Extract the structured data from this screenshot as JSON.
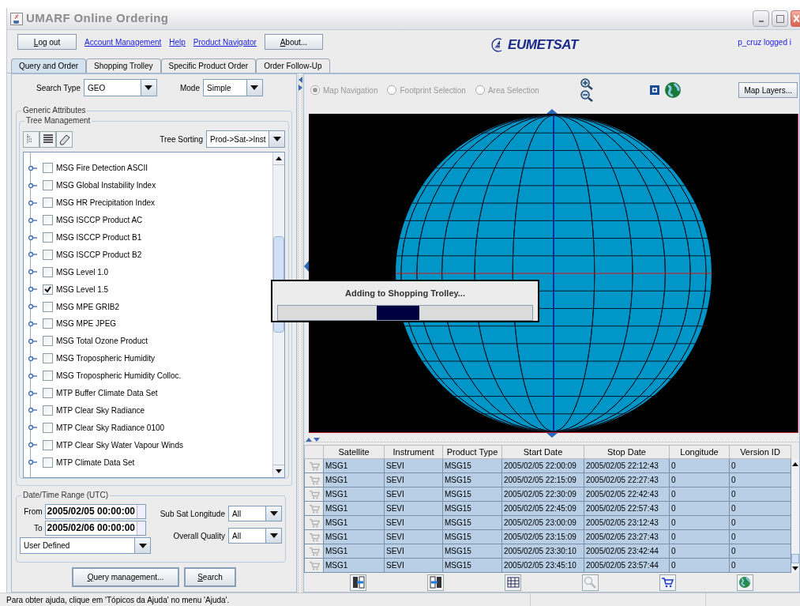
{
  "window": {
    "title": "UMARF Online Ordering"
  },
  "toolbar": {
    "logout_button": "Log out",
    "links": [
      "Account Management",
      "Help",
      "Product Navigator"
    ],
    "about_button": "About...",
    "logo": "EUMETSAT",
    "user": "p_cruz logged i"
  },
  "tabs": [
    {
      "label": "Query and Order",
      "selected": true
    },
    {
      "label": "Shopping Trolley",
      "selected": false
    },
    {
      "label": "Specific Product Order",
      "selected": false
    },
    {
      "label": "Order Follow-Up",
      "selected": false
    }
  ],
  "search": {
    "search_type_label": "Search Type",
    "search_type": "GEO",
    "mode_label": "Mode",
    "mode": "Simple"
  },
  "generic_attributes": {
    "title": "Generic Attributes",
    "tree_management": {
      "title": "Tree Management",
      "sorting_label": "Tree Sorting",
      "sorting": "Prod->Sat->Inst",
      "items": [
        {
          "label": "MSG Fire Detection ASCII",
          "checked": false
        },
        {
          "label": "MSG Global Instability Index",
          "checked": false
        },
        {
          "label": "MSG HR Precipitation Index",
          "checked": false
        },
        {
          "label": "MSG ISCCP Product AC",
          "checked": false
        },
        {
          "label": "MSG ISCCP Product B1",
          "checked": false
        },
        {
          "label": "MSG ISCCP Product B2",
          "checked": false
        },
        {
          "label": "MSG Level 1.0",
          "checked": false
        },
        {
          "label": "MSG Level 1.5",
          "checked": true
        },
        {
          "label": "MSG MPE GRIB2",
          "checked": false
        },
        {
          "label": "MSG MPE JPEG",
          "checked": false
        },
        {
          "label": "MSG Total Ozone Product",
          "checked": false
        },
        {
          "label": "MSG Tropospheric Humidity",
          "checked": false
        },
        {
          "label": "MSG Tropospheric Humidity Colloc.",
          "checked": false
        },
        {
          "label": "MTP Buffer Climate Data Set",
          "checked": false
        },
        {
          "label": "MTP Clear Sky Radiance",
          "checked": false
        },
        {
          "label": "MTP Clear Sky Radiance 0100",
          "checked": false
        },
        {
          "label": "MTP Clear Sky Water Vapour Winds",
          "checked": false
        },
        {
          "label": "MTP Climate Data Set",
          "checked": false
        }
      ]
    }
  },
  "date_range": {
    "title": "Date/Time Range (UTC)",
    "from_label": "From",
    "from": "2005/02/05 00:00:00",
    "to_label": "To",
    "to": "2005/02/06 00:00:00",
    "preset": "User Defined",
    "sub_sat_longitude_label": "Sub Sat Longitude",
    "sub_sat_longitude": "All",
    "overall_quality_label": "Overall Quality",
    "overall_quality": "All"
  },
  "actions": [
    "Query management...",
    "Search"
  ],
  "map": {
    "modes": [
      {
        "label": "Map Navigation",
        "selected": true
      },
      {
        "label": "Footprint Selection",
        "selected": false
      },
      {
        "label": "Area Selection",
        "selected": false
      }
    ],
    "layers_button": "Map Layers..."
  },
  "progress": {
    "message": "Adding to Shopping Trolley..."
  },
  "table": {
    "columns": [
      "Satellite",
      "Instrument",
      "Product Type",
      "Start Date",
      "Stop Date",
      "Longitude",
      "Version ID"
    ],
    "rows": [
      [
        "MSG1",
        "SEVI",
        "MSG15",
        "2005/02/05 22:00:09",
        "2005/02/05 22:12:43",
        "0",
        "0"
      ],
      [
        "MSG1",
        "SEVI",
        "MSG15",
        "2005/02/05 22:15:09",
        "2005/02/05 22:27:43",
        "0",
        "0"
      ],
      [
        "MSG1",
        "SEVI",
        "MSG15",
        "2005/02/05 22:30:09",
        "2005/02/05 22:42:43",
        "0",
        "0"
      ],
      [
        "MSG1",
        "SEVI",
        "MSG15",
        "2005/02/05 22:45:09",
        "2005/02/05 22:57:43",
        "0",
        "0"
      ],
      [
        "MSG1",
        "SEVI",
        "MSG15",
        "2005/02/05 23:00:09",
        "2005/02/05 23:12:43",
        "0",
        "0"
      ],
      [
        "MSG1",
        "SEVI",
        "MSG15",
        "2005/02/05 23:15:09",
        "2005/02/05 23:27:43",
        "0",
        "0"
      ],
      [
        "MSG1",
        "SEVI",
        "MSG15",
        "2005/02/05 23:30:10",
        "2005/02/05 23:42:44",
        "0",
        "0"
      ],
      [
        "MSG1",
        "SEVI",
        "MSG15",
        "2005/02/05 23:45:10",
        "2005/02/05 23:57:44",
        "0",
        "0"
      ]
    ]
  },
  "status_bar": {
    "text": "Para obter ajuda, clique em 'Tópicos da Ajuda' no menu 'Ajuda'."
  }
}
